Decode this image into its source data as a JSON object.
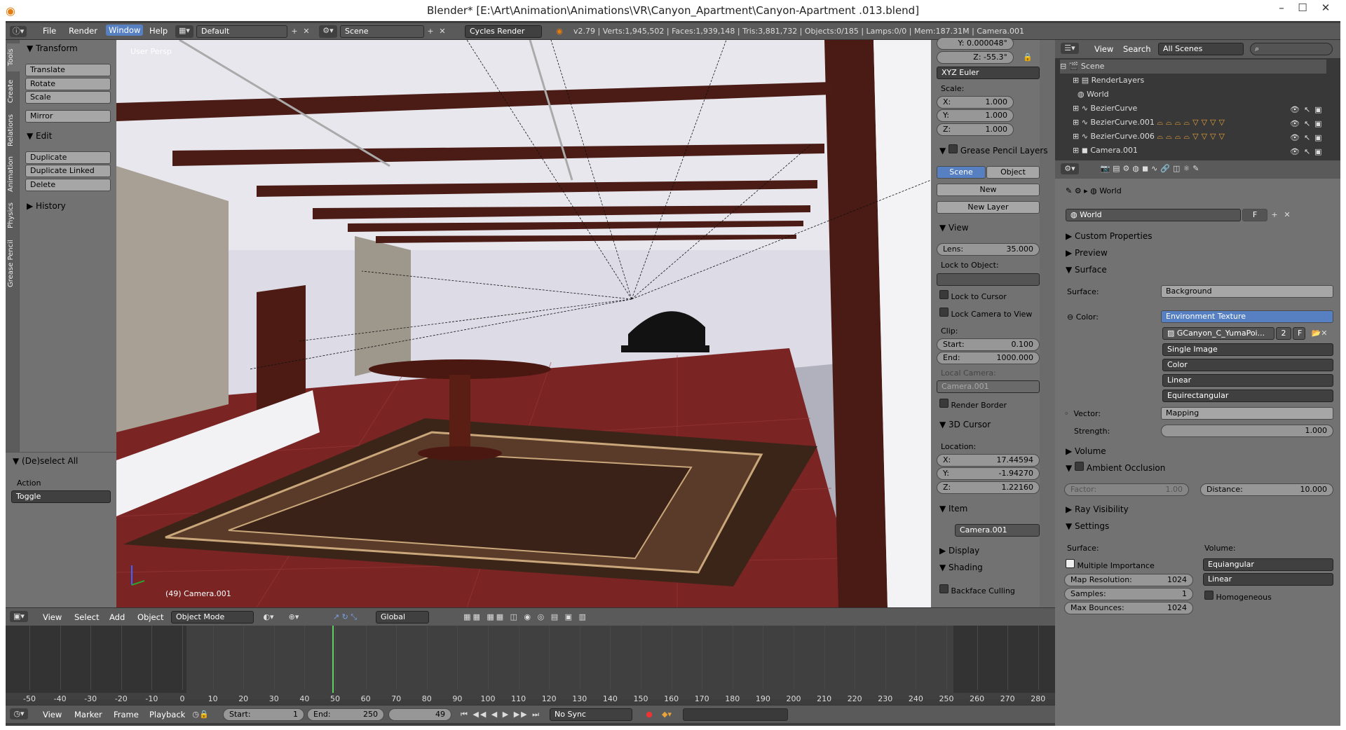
{
  "window": {
    "title": "Blender* [E:\\Art\\Animation\\Animations\\VR\\Canyon_Apartment\\Canyon-Apartment .013.blend]"
  },
  "infobar": {
    "menus": [
      "File",
      "Render",
      "Window",
      "Help"
    ],
    "screen_layout": "Default",
    "scene": "Scene",
    "engine": "Cycles Render",
    "stats": "v2.79 | Verts:1,945,502 | Faces:1,939,148 | Tris:3,881,732 | Objects:0/185 | Lamps:0/0 | Mem:187.31M | Camera.001"
  },
  "toolshelf": {
    "tabs": [
      "Tools",
      "Create",
      "Relations",
      "Animation",
      "Physics",
      "Grease Pencil"
    ],
    "transform_header": "Transform",
    "transform_buttons": [
      "Translate",
      "Rotate",
      "Scale",
      "Mirror"
    ],
    "edit_header": "Edit",
    "edit_buttons": [
      "Duplicate",
      "Duplicate Linked",
      "Delete"
    ],
    "history_header": "History",
    "operator_header": "(De)select All",
    "action_label": "Action",
    "action_value": "Toggle"
  },
  "viewport": {
    "view_label": "User Persp",
    "object_label": "(49) Camera.001"
  },
  "npanel": {
    "rot_y": "Y: 0.000048°",
    "rot_z": "Z: -55.3°",
    "rotation_mode": "XYZ Euler",
    "scale_label": "Scale:",
    "scale_x": "1.000",
    "scale_y": "1.000",
    "scale_z": "1.000",
    "gp_header": "Grease Pencil Layers",
    "gp_scene": "Scene",
    "gp_object": "Object",
    "gp_new": "New",
    "gp_new_layer": "New Layer",
    "view_header": "View",
    "lens_label": "Lens:",
    "lens_value": "35.000",
    "lock_label": "Lock to Object:",
    "lock_cursor": "Lock to Cursor",
    "lock_camera": "Lock Camera to View",
    "clip_label": "Clip:",
    "clip_start_label": "Start:",
    "clip_start": "0.100",
    "clip_end_label": "End:",
    "clip_end": "1000.000",
    "local_camera_label": "Local Camera:",
    "local_camera": "Camera.001",
    "render_border": "Render Border",
    "cursor_header": "3D Cursor",
    "location_label": "Location:",
    "cur_x": "17.44594",
    "cur_y": "-1.94270",
    "cur_z": "1.22160",
    "item_header": "Item",
    "item_name": "Camera.001",
    "display_header": "Display",
    "shading_header": "Shading",
    "backface": "Backface Culling"
  },
  "viewport_header": {
    "menus": [
      "View",
      "Select",
      "Add",
      "Object"
    ],
    "mode": "Object Mode",
    "orientation": "Global"
  },
  "timeline": {
    "ticks": [
      "-50",
      "-40",
      "-30",
      "-20",
      "-10",
      "0",
      "10",
      "20",
      "30",
      "40",
      "50",
      "60",
      "70",
      "80",
      "90",
      "100",
      "110",
      "120",
      "130",
      "140",
      "150",
      "160",
      "170",
      "180",
      "190",
      "200",
      "210",
      "220",
      "230",
      "240",
      "250",
      "260",
      "270",
      "280"
    ],
    "current_frame": 49,
    "menus": [
      "View",
      "Marker",
      "Frame",
      "Playback"
    ],
    "start_label": "Start:",
    "start": "1",
    "end_label": "End:",
    "end": "250",
    "frame": "49",
    "sync": "No Sync"
  },
  "outliner": {
    "menus": [
      "View",
      "Search"
    ],
    "filter": "All Scenes",
    "items": [
      "Scene",
      "RenderLayers",
      "World",
      "BezierCurve",
      "BezierCurve.001",
      "BezierCurve.006",
      "Camera.001"
    ]
  },
  "properties": {
    "context": "World",
    "world_name": "World",
    "world_f": "F",
    "custom_props": "Custom Properties",
    "preview": "Preview",
    "surface_header": "Surface",
    "surface_label": "Surface:",
    "surface_value": "Background",
    "color_label": "Color:",
    "color_value": "Environment Texture",
    "image_name": "GCanyon_C_YumaPoi...",
    "image_users": "2",
    "image_f": "F",
    "image_source": "Single Image",
    "color_space": "Color",
    "interpolation": "Linear",
    "projection": "Equirectangular",
    "vector_label": "Vector:",
    "vector_value": "Mapping",
    "strength_label": "Strength:",
    "strength_value": "1.000",
    "volume_header": "Volume",
    "ao_header": "Ambient Occlusion",
    "factor_label": "Factor:",
    "factor_value": "1.00",
    "distance_label": "Distance:",
    "distance_value": "10.000",
    "ray_vis_header": "Ray Visibility",
    "settings_header": "Settings",
    "set_surface_label": "Surface:",
    "set_volume_label": "Volume:",
    "multiple_importance": "Multiple Importance",
    "map_res_label": "Map Resolution:",
    "map_res": "1024",
    "samples_label": "Samples:",
    "samples": "1",
    "max_bounces_label": "Max Bounces:",
    "max_bounces": "1024",
    "vol_sampling": "Equiangular",
    "vol_interp": "Linear",
    "homogeneous": "Homogeneous"
  },
  "colors": {
    "accent": "#5680c2",
    "panel": "#727272",
    "header": "#5a5a5a",
    "current_frame": "#5fd35f"
  }
}
